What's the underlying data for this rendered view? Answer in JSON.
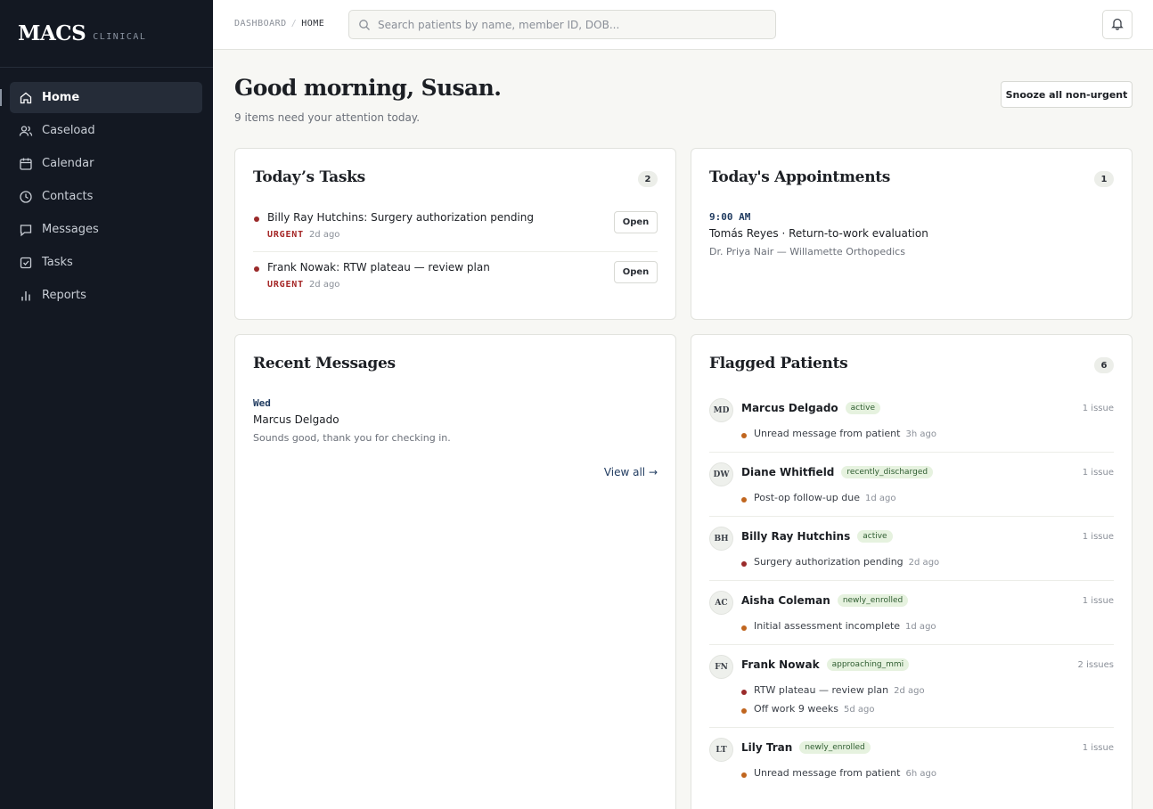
{
  "brand": {
    "name": "MACS",
    "sub": "CLINICAL"
  },
  "nav": [
    {
      "label": "Home",
      "icon": "home-icon",
      "active": true
    },
    {
      "label": "Caseload",
      "icon": "users-icon"
    },
    {
      "label": "Calendar",
      "icon": "calendar-icon"
    },
    {
      "label": "Contacts",
      "icon": "clock-icon"
    },
    {
      "label": "Messages",
      "icon": "message-icon"
    },
    {
      "label": "Tasks",
      "icon": "checkbox-icon"
    },
    {
      "label": "Reports",
      "icon": "bar-chart-icon"
    }
  ],
  "topbar": {
    "breadcrumb": [
      "DASHBOARD",
      "HOME"
    ],
    "separator": "/",
    "search_placeholder": "Search patients by name, member ID, DOB..."
  },
  "header": {
    "greeting": "Good morning, Susan.",
    "subtitle": "9 items need your attention today.",
    "snooze_label": "Snooze all non-urgent"
  },
  "tasks": {
    "title": "Today’s Tasks",
    "count": "2",
    "items": [
      {
        "title": "Billy Ray Hutchins: Surgery authorization pending",
        "priority": "URGENT",
        "age": "2d  ago",
        "action": "Open"
      },
      {
        "title": "Frank Nowak: RTW plateau — review plan",
        "priority": "URGENT",
        "age": "2d  ago",
        "action": "Open"
      }
    ]
  },
  "appointments": {
    "title": "Today's Appointments",
    "count": "1",
    "items": [
      {
        "time": "9:00 AM",
        "title": "Tomás Reyes · Return-to-work evaluation",
        "provider": "Dr. Priya Nair — Willamette Orthopedics"
      }
    ]
  },
  "messages": {
    "title": "Recent Messages",
    "items": [
      {
        "day": "Wed",
        "from": "Marcus Delgado",
        "text": "Sounds good, thank you for checking in."
      }
    ],
    "view_all": "View all →"
  },
  "flagged": {
    "title": "Flagged Patients",
    "count": "6",
    "patients": [
      {
        "initials": "MD",
        "name": "Marcus Delgado",
        "status": "active",
        "issues": "1 issue",
        "flags": [
          {
            "text": "Unread message from patient",
            "age": "3h  ago",
            "severity": "orange"
          }
        ]
      },
      {
        "initials": "DW",
        "name": "Diane Whitfield",
        "status": "recently_discharged",
        "issues": "1 issue",
        "flags": [
          {
            "text": "Post-op follow-up due",
            "age": "1d  ago",
            "severity": "orange"
          }
        ]
      },
      {
        "initials": "BH",
        "name": "Billy Ray Hutchins",
        "status": "active",
        "issues": "1 issue",
        "flags": [
          {
            "text": "Surgery authorization pending",
            "age": "2d  ago",
            "severity": "red"
          }
        ]
      },
      {
        "initials": "AC",
        "name": "Aisha Coleman",
        "status": "newly_enrolled",
        "issues": "1 issue",
        "flags": [
          {
            "text": "Initial assessment incomplete",
            "age": "1d  ago",
            "severity": "orange"
          }
        ]
      },
      {
        "initials": "FN",
        "name": "Frank Nowak",
        "status": "approaching_mmi",
        "issues": "2 issues",
        "flags": [
          {
            "text": "RTW plateau — review plan",
            "age": "2d  ago",
            "severity": "red"
          },
          {
            "text": "Off work 9 weeks",
            "age": "5d  ago",
            "severity": "orange"
          }
        ]
      },
      {
        "initials": "LT",
        "name": "Lily Tran",
        "status": "newly_enrolled",
        "issues": "1 issue",
        "flags": [
          {
            "text": "Unread message from patient",
            "age": "6h  ago",
            "severity": "orange"
          }
        ]
      }
    ]
  }
}
